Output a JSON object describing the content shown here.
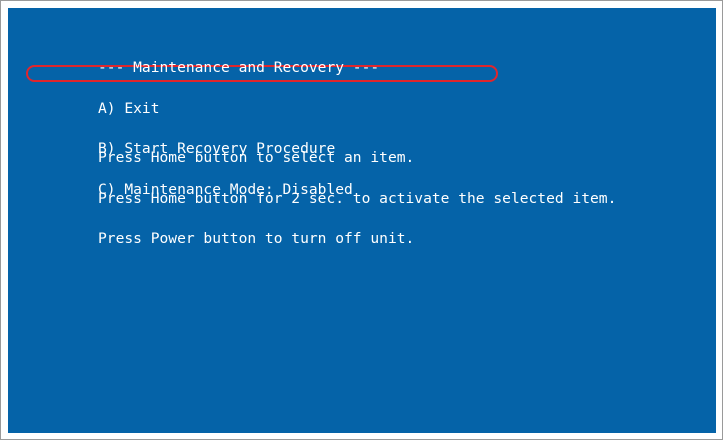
{
  "menu": {
    "title": "--- Maintenance and Recovery ---",
    "items": [
      {
        "label": "A) Exit"
      },
      {
        "label": "B) Start Recovery Procedure",
        "highlighted": true
      },
      {
        "label": "C) Maintenance Mode: Disabled"
      }
    ]
  },
  "instructions": [
    "Press Home button to select an item.",
    "Press Home button for 2 sec. to activate the selected item.",
    "Press Power button to turn off unit."
  ],
  "colors": {
    "screen_background": "#0563a8",
    "text": "#ffffff",
    "highlight_ring": "#e0262c"
  }
}
